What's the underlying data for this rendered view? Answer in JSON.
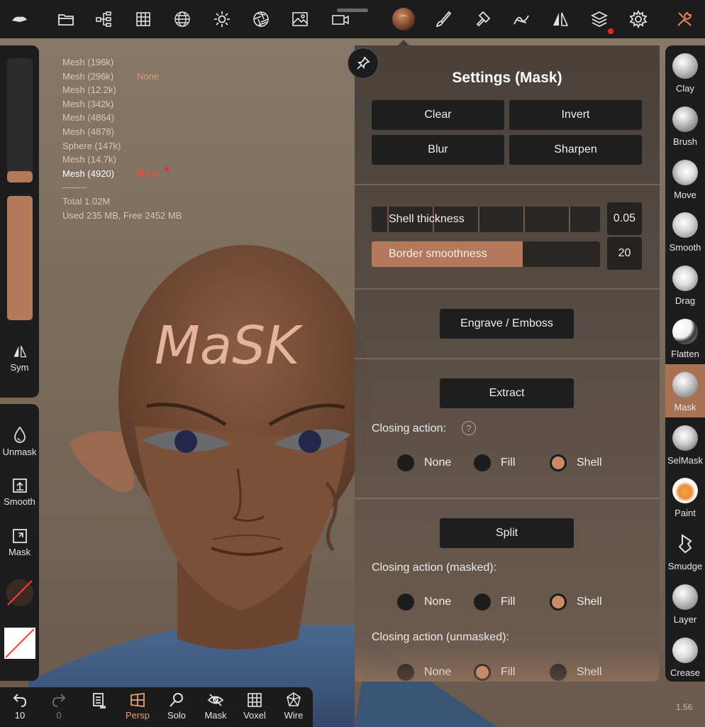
{
  "viewport": {
    "mesh_list": [
      {
        "name": "Mesh (196k)",
        "tag": ""
      },
      {
        "name": "Mesh (296k)",
        "tag": "None"
      },
      {
        "name": "Mesh (12.2k)",
        "tag": ""
      },
      {
        "name": "Mesh (342k)",
        "tag": ""
      },
      {
        "name": "Mesh (4864)",
        "tag": ""
      },
      {
        "name": "Mesh (4878)",
        "tag": ""
      },
      {
        "name": "Sphere (147k)",
        "tag": ""
      },
      {
        "name": "Mesh (14.7k)",
        "tag": ""
      },
      {
        "name": "Mesh (4920)",
        "tag": "None"
      },
      {
        "name": "--------",
        "tag": ""
      },
      {
        "name": "Total 1.02M",
        "tag": ""
      },
      {
        "name": "Used 235 MB,  Free 2452 MB",
        "tag": ""
      }
    ],
    "painted_text": "MaSK",
    "version": "1.56"
  },
  "top_toolbar": {
    "icons": [
      "nomad-logo-icon",
      "folder-icon",
      "scene-tree-icon",
      "grid-icon",
      "sphere-wire-icon",
      "sun-icon",
      "aperture-icon",
      "image-icon",
      "camera-icon",
      "matcap-icon",
      "brush-icon",
      "paint-roller-icon",
      "stroke-icon",
      "symmetry-icon",
      "layers-icon",
      "settings-icon",
      "tools-icon"
    ]
  },
  "left_panel": {
    "radius_slider_fill": 0.06,
    "intensity_slider_fill": 1.0,
    "sym_label": "Sym",
    "actions": [
      {
        "label": "Unmask",
        "icon": "drop-icon"
      },
      {
        "label": "Smooth",
        "icon": "arrow-up-box-icon"
      },
      {
        "label": "Mask",
        "icon": "arrow-corner-box-icon"
      }
    ]
  },
  "right_tools": [
    {
      "label": "Clay",
      "selected": false
    },
    {
      "label": "Brush",
      "selected": false
    },
    {
      "label": "Move",
      "selected": false
    },
    {
      "label": "Smooth",
      "selected": false
    },
    {
      "label": "Drag",
      "selected": false
    },
    {
      "label": "Flatten",
      "selected": false
    },
    {
      "label": "Mask",
      "selected": true
    },
    {
      "label": "SelMask",
      "selected": false
    },
    {
      "label": "Paint",
      "selected": false
    },
    {
      "label": "Smudge",
      "selected": false
    },
    {
      "label": "Layer",
      "selected": false
    },
    {
      "label": "Crease",
      "selected": false
    }
  ],
  "bottom_toolbar": {
    "undo": {
      "count": "10"
    },
    "redo": {
      "count": "0"
    },
    "items": [
      {
        "label": "Persp",
        "icon": "perspective-icon"
      },
      {
        "label": "Solo",
        "icon": "search-icon"
      },
      {
        "label": "Mask",
        "icon": "eye-off-icon"
      },
      {
        "label": "Voxel",
        "icon": "voxel-grid-icon"
      },
      {
        "label": "Wire",
        "icon": "wireframe-icon"
      }
    ]
  },
  "settings": {
    "title": "Settings (Mask)",
    "clear": "Clear",
    "invert": "Invert",
    "blur": "Blur",
    "sharpen": "Sharpen",
    "shell_thickness": {
      "label": "Shell thickness",
      "value": "0.05",
      "fill": 0.0
    },
    "border_smoothness": {
      "label": "Border smoothness",
      "value": "20",
      "fill": 0.66
    },
    "engrave": "Engrave / Emboss",
    "extract": "Extract",
    "closing_action_label": "Closing action:",
    "help": "?",
    "extract_options": [
      {
        "label": "None",
        "checked": false
      },
      {
        "label": "Fill",
        "checked": false
      },
      {
        "label": "Shell",
        "checked": true
      }
    ],
    "split": "Split",
    "closing_masked_label": "Closing action (masked):",
    "masked_options": [
      {
        "label": "None",
        "checked": false
      },
      {
        "label": "Fill",
        "checked": false
      },
      {
        "label": "Shell",
        "checked": true
      }
    ],
    "closing_unmasked_label": "Closing action (unmasked):",
    "unmasked_options": [
      {
        "label": "None",
        "checked": false
      },
      {
        "label": "Fill",
        "checked": true
      },
      {
        "label": "Shell",
        "checked": false
      }
    ]
  },
  "colors": {
    "accent": "#b4795a",
    "skin": "#7a5038",
    "shirt": "#3e5a7e"
  }
}
